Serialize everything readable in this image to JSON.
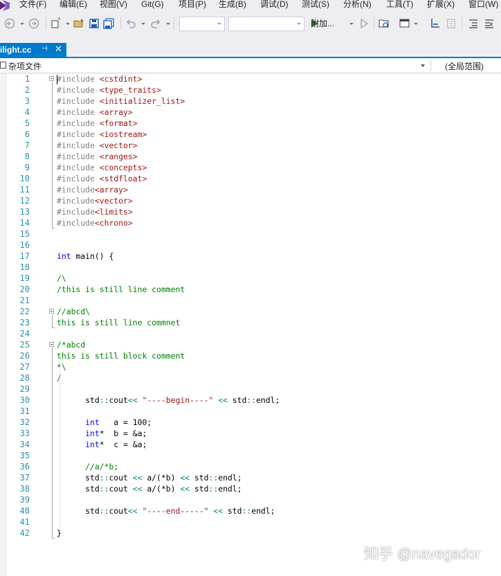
{
  "menu": {
    "items": [
      "文件(F)",
      "编辑(E)",
      "视图(V)",
      "Git(G)",
      "项目(P)",
      "生成(B)",
      "调试(D)",
      "测试(S)",
      "分析(N)",
      "工具(T)",
      "扩展(X)",
      "窗口(W)"
    ]
  },
  "toolbar": {
    "attach_label": "附加...",
    "solution_config": "",
    "solution_platform": ""
  },
  "tab": {
    "title": "ilight.cc",
    "pin_icon": "pin-icon",
    "close_icon": "close-icon"
  },
  "navbar": {
    "project": "杂项文件",
    "scope": "(全局范围)"
  },
  "editor": {
    "line_numbers": [
      "1",
      "2",
      "3",
      "4",
      "5",
      "6",
      "7",
      "8",
      "9",
      "10",
      "11",
      "12",
      "13",
      "14",
      "15",
      "16",
      "17",
      "18",
      "19",
      "20",
      "21",
      "22",
      "23",
      "24",
      "25",
      "26",
      "27",
      "28",
      "29",
      "30",
      "31",
      "32",
      "33",
      "34",
      "35",
      "36",
      "37",
      "38",
      "39",
      "40",
      "41",
      "42"
    ],
    "lines": [
      [
        [
          "pp",
          "#include "
        ],
        [
          "inc",
          "<cstdint>"
        ]
      ],
      [
        [
          "pp",
          "#include "
        ],
        [
          "inc",
          "<type_traits>"
        ]
      ],
      [
        [
          "pp",
          "#include "
        ],
        [
          "inc",
          "<initializer_list>"
        ]
      ],
      [
        [
          "pp",
          "#include "
        ],
        [
          "inc",
          "<array>"
        ]
      ],
      [
        [
          "pp",
          "#include "
        ],
        [
          "inc",
          "<format>"
        ]
      ],
      [
        [
          "pp",
          "#include "
        ],
        [
          "inc",
          "<iostream>"
        ]
      ],
      [
        [
          "pp",
          "#include "
        ],
        [
          "inc",
          "<vector>"
        ]
      ],
      [
        [
          "pp",
          "#include "
        ],
        [
          "inc",
          "<ranges>"
        ]
      ],
      [
        [
          "pp",
          "#include "
        ],
        [
          "inc",
          "<concepts>"
        ]
      ],
      [
        [
          "pp",
          "#include "
        ],
        [
          "inc",
          "<stdfloat>"
        ]
      ],
      [
        [
          "pp",
          "#include"
        ],
        [
          "inc",
          "<array>"
        ]
      ],
      [
        [
          "pp",
          "#include"
        ],
        [
          "inc",
          "<vector>"
        ]
      ],
      [
        [
          "pp",
          "#include"
        ],
        [
          "inc",
          "<limits>"
        ]
      ],
      [
        [
          "pp",
          "#include"
        ],
        [
          "inc",
          "<chrono>"
        ]
      ],
      [],
      [],
      [
        [
          "kw",
          "int"
        ],
        [
          "tx",
          " main() {"
        ]
      ],
      [],
      [
        [
          "cm",
          "/\\"
        ]
      ],
      [
        [
          "cm",
          "/this is still line comment"
        ]
      ],
      [],
      [
        [
          "cm",
          "//abcd\\"
        ]
      ],
      [
        [
          "cm",
          "this is still line commnet"
        ]
      ],
      [],
      [
        [
          "cm",
          "/*abcd"
        ]
      ],
      [
        [
          "cm",
          "this is still block comment"
        ]
      ],
      [
        [
          "cm",
          "*\\"
        ]
      ],
      [
        [
          "cm",
          "/"
        ]
      ],
      [],
      [
        [
          "tx",
          "      std"
        ],
        [
          "op",
          "::"
        ],
        [
          "tx",
          "cout"
        ],
        [
          "op",
          "<<"
        ],
        [
          "tx",
          " "
        ],
        [
          "str",
          "\"----begin----\""
        ],
        [
          "tx",
          " "
        ],
        [
          "op",
          "<<"
        ],
        [
          "tx",
          " std"
        ],
        [
          "op",
          "::"
        ],
        [
          "tx",
          "endl;"
        ]
      ],
      [],
      [
        [
          "tx",
          "      "
        ],
        [
          "kw",
          "int"
        ],
        [
          "tx",
          "   a = 100;"
        ]
      ],
      [
        [
          "tx",
          "      "
        ],
        [
          "kw",
          "int"
        ],
        [
          "tx",
          "*  b = &a;"
        ]
      ],
      [
        [
          "tx",
          "      "
        ],
        [
          "kw",
          "int"
        ],
        [
          "tx",
          "*  c = &a;"
        ]
      ],
      [],
      [
        [
          "tx",
          "      "
        ],
        [
          "cm",
          "//a/*b;"
        ]
      ],
      [
        [
          "tx",
          "      std"
        ],
        [
          "op",
          "::"
        ],
        [
          "tx",
          "cout "
        ],
        [
          "op",
          "<<"
        ],
        [
          "tx",
          " a/(*b) "
        ],
        [
          "op",
          "<<"
        ],
        [
          "tx",
          " std"
        ],
        [
          "op",
          "::"
        ],
        [
          "tx",
          "endl;"
        ]
      ],
      [
        [
          "tx",
          "      std"
        ],
        [
          "op",
          "::"
        ],
        [
          "tx",
          "cout "
        ],
        [
          "op",
          "<<"
        ],
        [
          "tx",
          " a/(*b) "
        ],
        [
          "op",
          "<<"
        ],
        [
          "tx",
          " std"
        ],
        [
          "op",
          "::"
        ],
        [
          "tx",
          "endl;"
        ]
      ],
      [],
      [
        [
          "tx",
          "      std"
        ],
        [
          "op",
          "::"
        ],
        [
          "tx",
          "cout"
        ],
        [
          "op",
          "<<"
        ],
        [
          "tx",
          " "
        ],
        [
          "str",
          "\"----end-----\""
        ],
        [
          "tx",
          " "
        ],
        [
          "op",
          "<<"
        ],
        [
          "tx",
          " std"
        ],
        [
          "op",
          "::"
        ],
        [
          "tx",
          "endl;"
        ]
      ],
      [],
      [
        [
          "tx",
          "}"
        ]
      ]
    ]
  },
  "watermark": "知乎 @navegador",
  "colors": {
    "accent": "#007acc",
    "line_number": "#2b91af",
    "keyword": "#0000ff",
    "preprocessor": "#808080",
    "include_path": "#a31515",
    "comment": "#008000",
    "string": "#a31515",
    "operator": "#008080"
  }
}
